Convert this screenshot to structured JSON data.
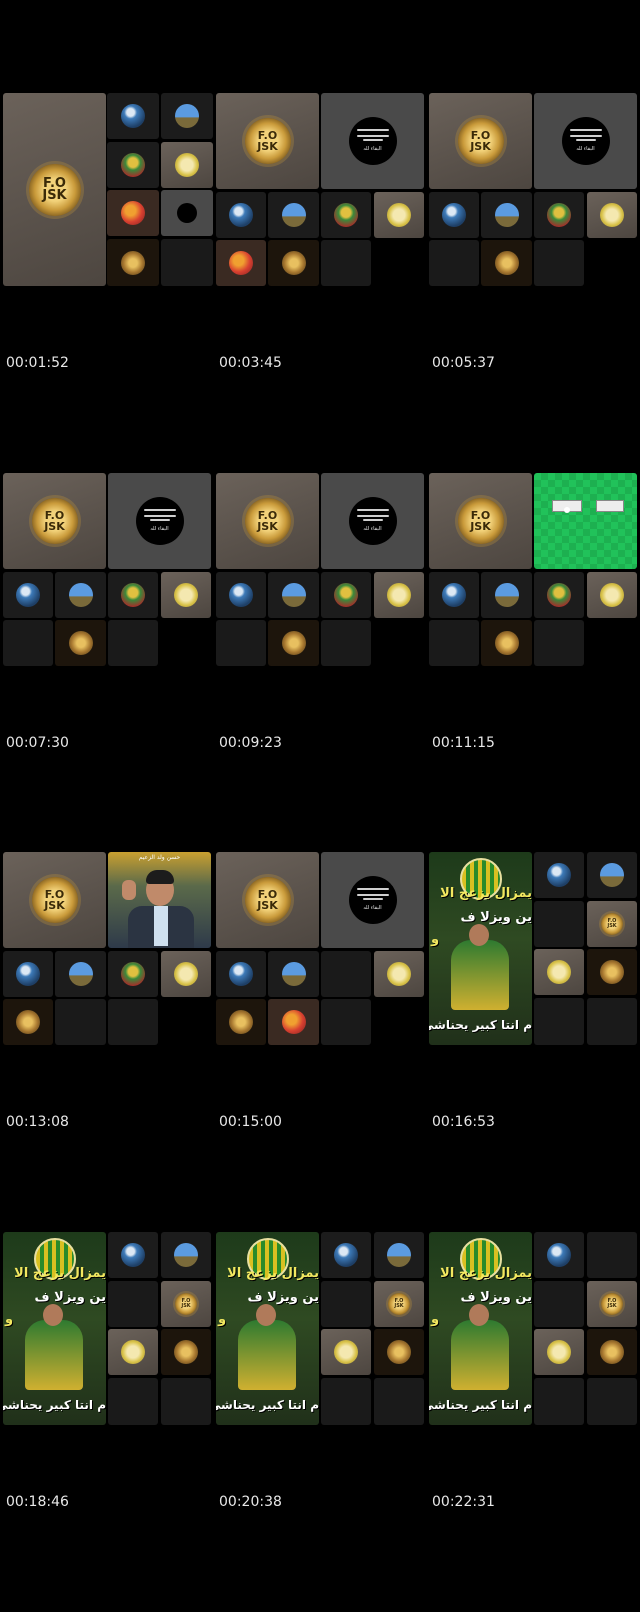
{
  "timestamps": [
    "00:01:52",
    "00:03:45",
    "00:05:37",
    "00:07:30",
    "00:09:23",
    "00:11:15",
    "00:13:08",
    "00:15:00",
    "00:16:53",
    "00:18:46",
    "00:20:38",
    "00:22:31"
  ],
  "logo_text": {
    "line1": "F.O",
    "line2": "JSK"
  },
  "disc_text": "البقاء لله",
  "photo_caption": "حسن ولد الزعيم",
  "poster_lines": [
    "يمزال يزعج الا",
    "ين ويزلا ف",
    "و",
    "م انتا كبير يحناشي"
  ],
  "icons": {
    "avatar_blue": "player-photo-icon",
    "avatar_sky": "landscape-icon",
    "avatar_team": "team-photo-icon",
    "avatar_yellow": "portrait-icon",
    "avatar_red": "player-red-icon",
    "avatar_gold": "gold-badge-icon",
    "condolence_disc": "condolence-disc-icon"
  },
  "colors": {
    "background": "#000000",
    "tile": "#5b544e",
    "green_screen": "#21c25a",
    "text": "#e8e8e8"
  }
}
